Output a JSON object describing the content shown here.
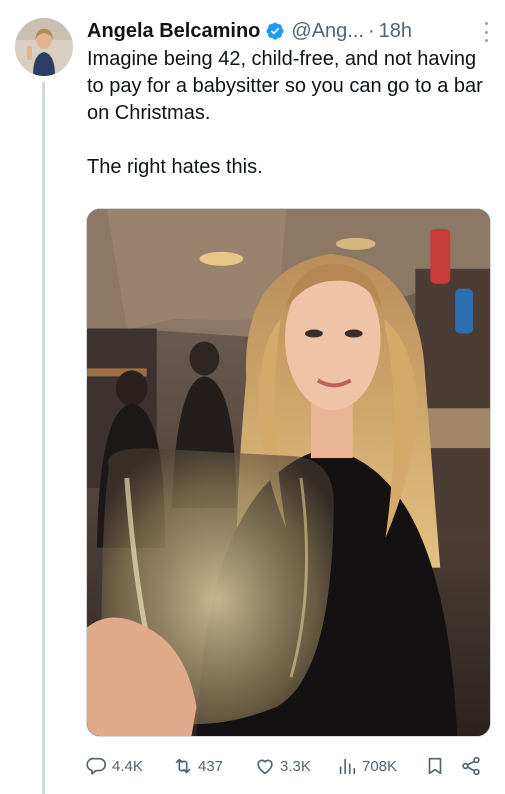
{
  "tweet": {
    "author_name": "Angela Belcamino",
    "handle": "@Ang...",
    "separator": "·",
    "time": "18h",
    "paragraphs": [
      "Imagine being 42, child-free, and not having to pay for a babysitter so you can go to a bar on Christmas.",
      "The right hates this."
    ]
  },
  "actions": {
    "replies": "4.4K",
    "reposts": "437",
    "likes": "3.3K",
    "views": "708K"
  },
  "icons": {
    "verified": "verified-badge-icon",
    "more": "more-options-icon",
    "reply": "reply-icon",
    "repost": "repost-icon",
    "like": "heart-icon",
    "views": "views-icon",
    "bookmark": "bookmark-icon",
    "share": "share-icon"
  },
  "colors": {
    "verified_blue": "#1d9bf0",
    "secondary_text": "#536471",
    "thread_line": "#cfd9de"
  }
}
